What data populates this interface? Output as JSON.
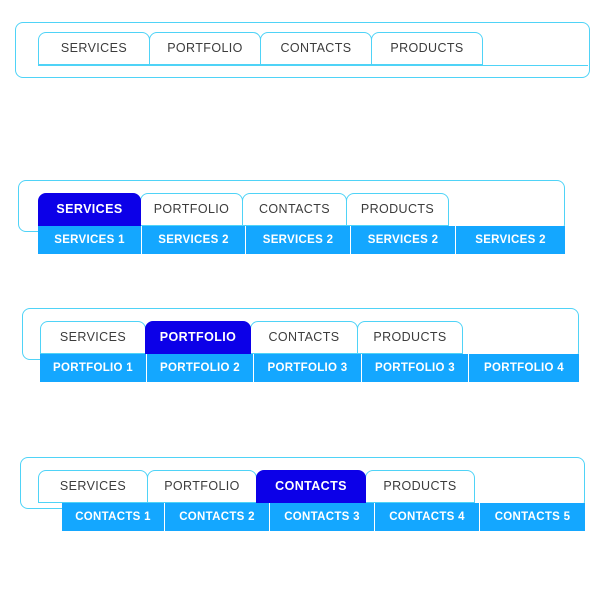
{
  "theme": {
    "accent_border": "#4fd3f7",
    "active_tab_bg": "#0c00e8",
    "submenu_bg": "#14a7ff",
    "tab_text": "#3c3c3c",
    "active_text": "#ffffff"
  },
  "widgets": [
    {
      "id": "menu-plain",
      "tabs": [
        {
          "label": "SERVICES",
          "active": false
        },
        {
          "label": "PORTFOLIO",
          "active": false
        },
        {
          "label": "CONTACTS",
          "active": false
        },
        {
          "label": "PRODUCTS",
          "active": false
        }
      ],
      "submenu": []
    },
    {
      "id": "menu-services",
      "tabs": [
        {
          "label": "SERVICES",
          "active": true
        },
        {
          "label": "PORTFOLIO",
          "active": false
        },
        {
          "label": "CONTACTS",
          "active": false
        },
        {
          "label": "PRODUCTS",
          "active": false
        }
      ],
      "submenu": [
        {
          "label": "SERVICES 1"
        },
        {
          "label": "SERVICES 2"
        },
        {
          "label": "SERVICES 2"
        },
        {
          "label": "SERVICES 2"
        },
        {
          "label": "SERVICES 2"
        }
      ]
    },
    {
      "id": "menu-portfolio",
      "tabs": [
        {
          "label": "SERVICES",
          "active": false
        },
        {
          "label": "PORTFOLIO",
          "active": true
        },
        {
          "label": "CONTACTS",
          "active": false
        },
        {
          "label": "PRODUCTS",
          "active": false
        }
      ],
      "submenu": [
        {
          "label": "PORTFOLIO 1"
        },
        {
          "label": "PORTFOLIO 2"
        },
        {
          "label": "PORTFOLIO 3"
        },
        {
          "label": "PORTFOLIO 3"
        },
        {
          "label": "PORTFOLIO 4"
        }
      ]
    },
    {
      "id": "menu-contacts",
      "tabs": [
        {
          "label": "SERVICES",
          "active": false
        },
        {
          "label": "PORTFOLIO",
          "active": false
        },
        {
          "label": "CONTACTS",
          "active": true
        },
        {
          "label": "PRODUCTS",
          "active": false
        }
      ],
      "submenu": [
        {
          "label": "CONTACTS 1"
        },
        {
          "label": "CONTACTS 2"
        },
        {
          "label": "CONTACTS 3"
        },
        {
          "label": "CONTACTS 4"
        },
        {
          "label": "CONTACTS 5"
        }
      ]
    }
  ]
}
